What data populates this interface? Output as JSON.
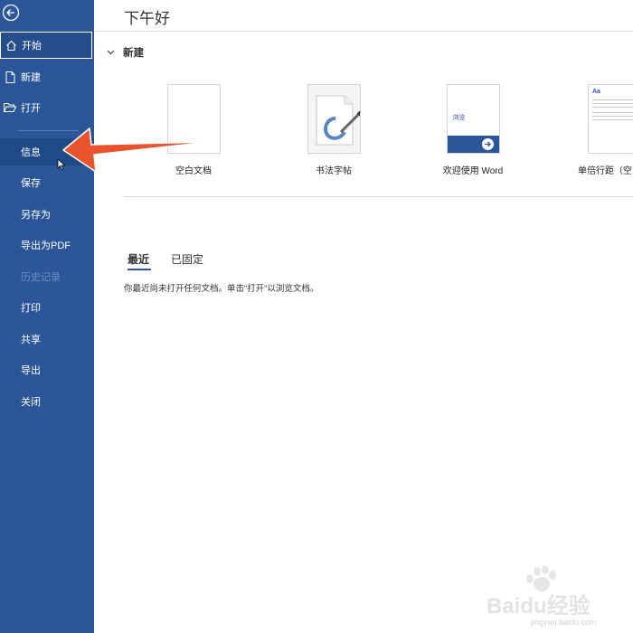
{
  "sidebar": {
    "items": [
      {
        "label": "开始",
        "icon": "home-icon"
      },
      {
        "label": "新建",
        "icon": "new-document-icon"
      },
      {
        "label": "打开",
        "icon": "folder-open-icon"
      },
      {
        "label": "信息"
      },
      {
        "label": "保存"
      },
      {
        "label": "另存为"
      },
      {
        "label": "导出为PDF"
      },
      {
        "label": "历史记录"
      },
      {
        "label": "打印"
      },
      {
        "label": "共享"
      },
      {
        "label": "导出"
      },
      {
        "label": "关闭"
      }
    ]
  },
  "main": {
    "greeting": "下午好",
    "new_section": {
      "title": "新建",
      "templates": [
        {
          "caption": "空白文档"
        },
        {
          "caption": "书法字帖"
        },
        {
          "caption": "欢迎使用 Word",
          "thumb_text": "浏览"
        },
        {
          "caption": "单倍行距（空",
          "thumb_text": "Aa"
        }
      ]
    },
    "tabs": [
      "最近",
      "已固定"
    ],
    "empty_message": "你最近尚未打开任何文档。单击“打开”以浏览文档。"
  },
  "watermark": {
    "text": "Baidu经验",
    "url": "jingyan.baidu.com"
  },
  "colors": {
    "sidebar": "#2b579a",
    "accent": "#2b579a",
    "arrow": "#e8552c"
  }
}
